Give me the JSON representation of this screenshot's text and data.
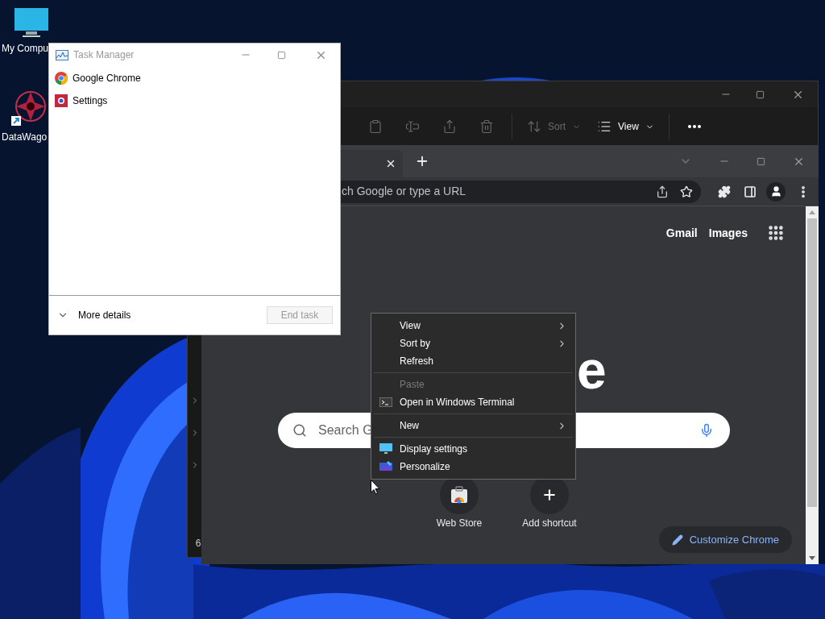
{
  "desktop": {
    "icons": [
      {
        "label": "My Compu",
        "kind": "computer"
      },
      {
        "label": "DataWago",
        "kind": "shortcut"
      }
    ]
  },
  "explorer": {
    "toolbar": [
      {
        "kind": "paste",
        "disabled": true
      },
      {
        "kind": "rename",
        "disabled": true
      },
      {
        "kind": "share",
        "disabled": true
      },
      {
        "kind": "delete",
        "disabled": true
      },
      {
        "kind": "separator"
      },
      {
        "kind": "sort",
        "label": "Sort",
        "disabled": true
      },
      {
        "kind": "view",
        "label": "View",
        "disabled": false
      },
      {
        "kind": "separator"
      },
      {
        "kind": "more",
        "disabled": false
      }
    ],
    "nav_label": "6"
  },
  "chrome": {
    "address": {
      "placeholder": "ch Google or type a URL"
    },
    "header_links": [
      "Gmail",
      "Images"
    ],
    "logo_fragment": "e",
    "search": {
      "placeholder": "Search G"
    },
    "shortcuts": [
      {
        "label": "Web Store",
        "kind": "store"
      },
      {
        "label": "Add shortcut",
        "kind": "add"
      }
    ],
    "customize_button": "Customize Chrome"
  },
  "task_manager": {
    "title": "Task Manager",
    "active": false,
    "apps": [
      {
        "name": "Google Chrome",
        "kind": "chrome"
      },
      {
        "name": "Settings",
        "kind": "settings"
      }
    ],
    "more_details": "More details",
    "end_task": {
      "label": "End task",
      "disabled": true
    }
  },
  "context_menu": {
    "items": [
      {
        "kind": "item",
        "label": "View",
        "submenu": true,
        "disabled": false
      },
      {
        "kind": "item",
        "label": "Sort by",
        "submenu": true,
        "disabled": false
      },
      {
        "kind": "item",
        "label": "Refresh",
        "submenu": false,
        "disabled": false
      },
      {
        "kind": "separator"
      },
      {
        "kind": "item",
        "label": "Paste",
        "submenu": false,
        "disabled": true
      },
      {
        "kind": "terminal",
        "label": "Open in Windows Terminal",
        "submenu": false,
        "disabled": false
      },
      {
        "kind": "separator"
      },
      {
        "kind": "item",
        "label": "New",
        "submenu": true,
        "disabled": false
      },
      {
        "kind": "separator"
      },
      {
        "kind": "display",
        "label": "Display settings",
        "submenu": false,
        "disabled": false
      },
      {
        "kind": "personalize",
        "label": "Personalize",
        "submenu": false,
        "disabled": false
      }
    ]
  }
}
